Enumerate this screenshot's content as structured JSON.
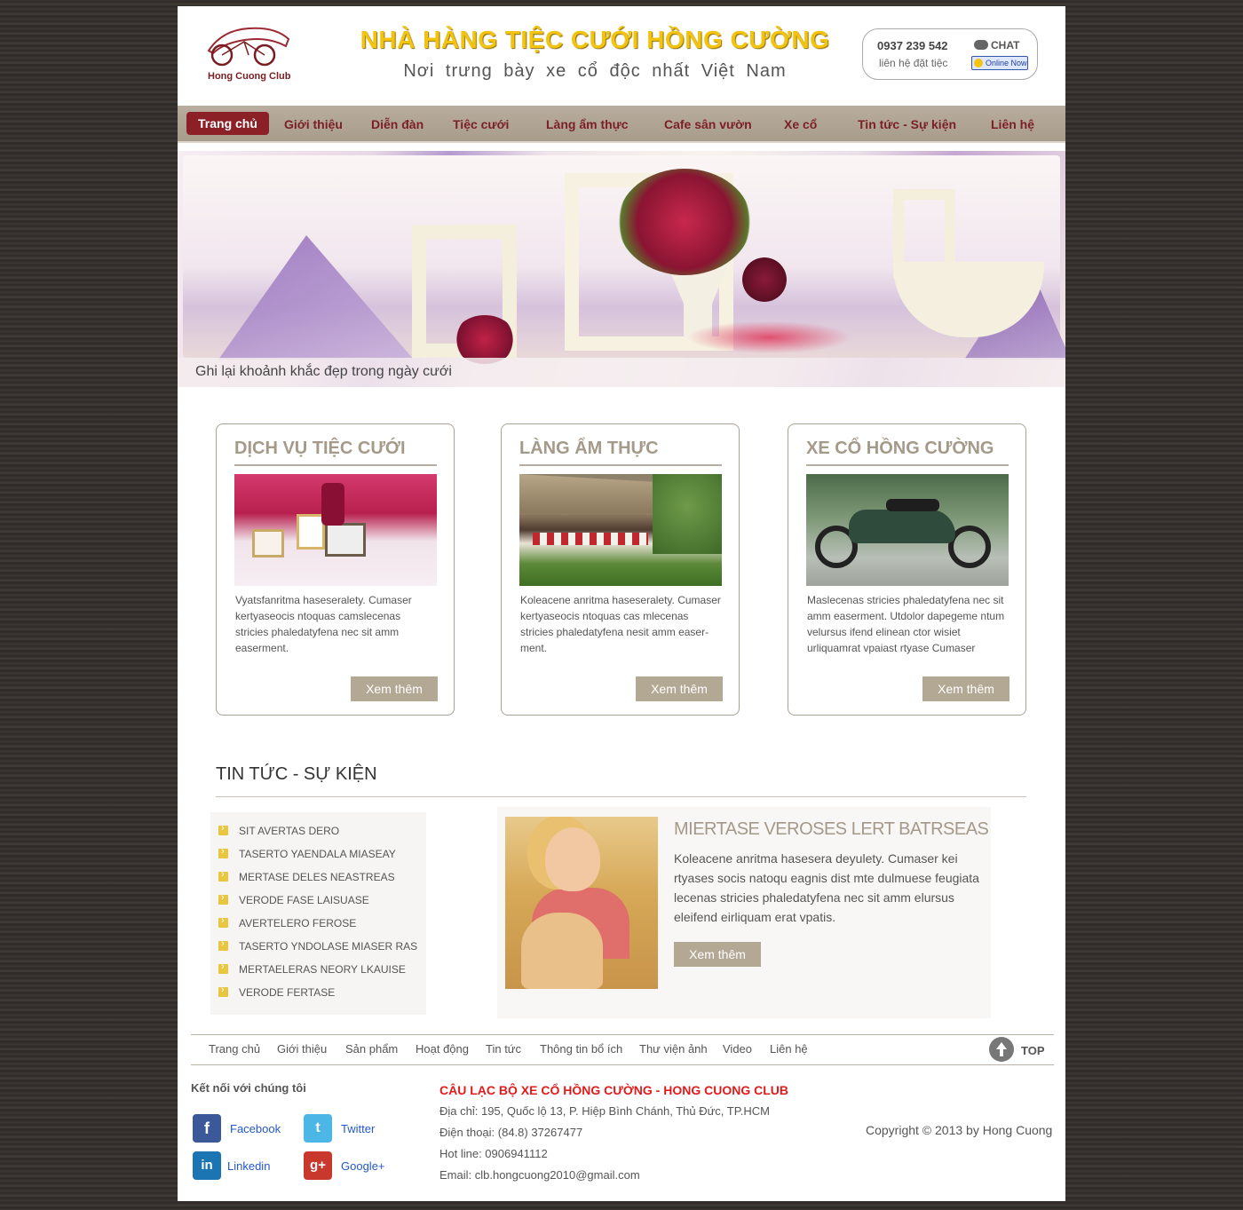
{
  "header": {
    "logo_text": "Hong Cuong Club",
    "title": "NHÀ HÀNG TIỆC CƯỚI HỒNG CƯỜNG",
    "subtitle": "Nơi trưng bày xe cổ độc nhất Việt Nam",
    "phone": "0937 239 542",
    "phone_note": "liên hệ đặt tiệc",
    "chat_label": "CHAT",
    "online_label": "Online Now"
  },
  "nav": {
    "items": [
      "Trang chủ",
      "Giới thiệu",
      "Diễn đàn",
      "Tiệc cưới",
      "Làng ẩm thực",
      "Cafe sân vườn",
      "Xe cổ",
      "Tin tức - Sự kiện",
      "Liên hệ"
    ],
    "active": "Trang chủ"
  },
  "banner": {
    "caption": "Ghi lại khoảnh khắc đẹp trong ngày cưới"
  },
  "services": [
    {
      "title": "DỊCH VỤ TIỆC CƯỚI",
      "text": "Vyatsfanritma haseseralety. Cumaser kertyaseocis ntoquas camslecenas stricies phaledatyfena nec sit amm easerment.",
      "button": "Xem thêm"
    },
    {
      "title": "LÀNG ẨM THỰC",
      "text": "Koleacene anritma haseseralety. Cumaser kertyaseocis ntoquas cas mlecenas stricies phaledatyfena nesit amm easer-ment.",
      "button": "Xem thêm"
    },
    {
      "title": "XE CỔ HỒNG CƯỜNG",
      "text": "Maslecenas stricies phaledatyfena nec sit amm easerment. Utdolor dapegeme ntum velursus ifend elinean ctor wisiet urliquamrat vpaiast rtyase Cumaser",
      "button": "Xem thêm"
    }
  ],
  "news": {
    "title": "TIN TỨC - SỰ KIỆN",
    "items": [
      "SIT AVERTAS DERO",
      "TASERTO YAENDALA MIASEAY",
      "MERTASE DELES NEASTREAS",
      "VERODE FASE LAISUASE",
      "AVERTELERO FEROSE",
      "TASERTO YNDOLASE MIASER RAS",
      "MERTAELERAS NEORY LKAUISE",
      "VERODE FERTASE"
    ],
    "feature": {
      "heading": "MIERTASE VEROSES LERT BATRSEAS",
      "text": "Koleacene anritma hasesera deyulety. Cumaser kei rtyases socis natoqu eagnis dist mte dulmuese feugiata lecenas stricies phaledatyfena nec sit amm elursus eleifend eirliquam erat vpatis.",
      "button": "Xem thêm"
    }
  },
  "footer": {
    "nav": [
      "Trang chủ",
      "Giới thiệu",
      "Sản phẩm",
      "Hoạt động",
      "Tin tức",
      "Thông tin bổ ích",
      "Thư viện ảnh",
      "Video",
      "Liên hệ"
    ],
    "top_label": "TOP",
    "connect_title": "Kết nối với chúng tôi",
    "social": {
      "facebook": "Facebook",
      "twitter": "Twitter",
      "linkedin": "Linkedin",
      "googleplus": "Google+"
    },
    "club_name": "CÂU LẠC BỘ XE CỔ HỒNG CƯỜNG - HONG CUONG CLUB",
    "address": "Địa chỉ: 195, Quốc lộ 13, P. Hiệp Bình Chánh, Thủ Đức, TP.HCM",
    "phone": "Điện thoại: (84.8) 37267477",
    "hotline": "Hot line: 0906941112",
    "email": "Email: clb.hongcuong2010@gmail.com",
    "copyright": "Copyright © 2013 by Hong Cuong"
  },
  "colors": {
    "accent": "#8c2027",
    "nav_bg": "#b1a694",
    "title_yellow": "#f2c40e",
    "button": "#b3a894"
  }
}
